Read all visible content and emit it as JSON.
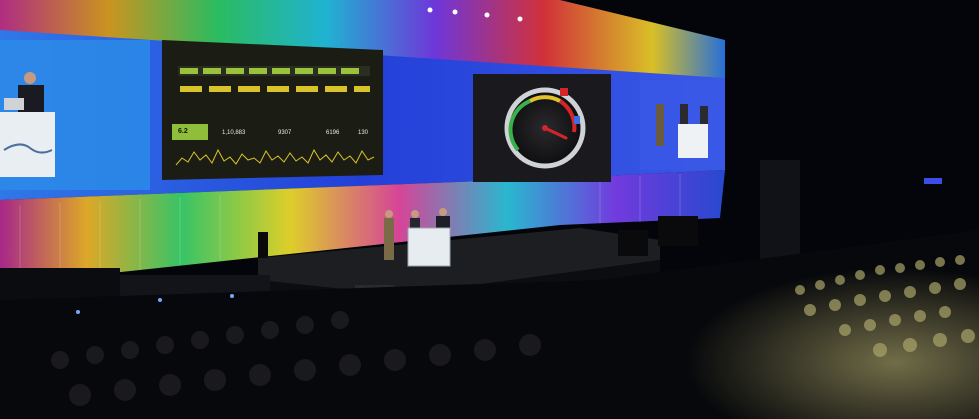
{
  "scene": {
    "description_label": "",
    "dashboard": {
      "title": "",
      "metric_1": "6.2",
      "metric_2": "1,10,883",
      "metric_3": "9307",
      "metric_4": "6196",
      "metric_5": "130"
    },
    "gauge": {
      "level": 0.62
    },
    "colors": {
      "screen_blue": "#1f3fd6",
      "dashboard_bg": "#1b1d15",
      "accent_green": "#9ac23a",
      "accent_yellow": "#d9c32a",
      "gauge_red": "#d2262b",
      "stage_floor": "#1d1e22"
    }
  }
}
